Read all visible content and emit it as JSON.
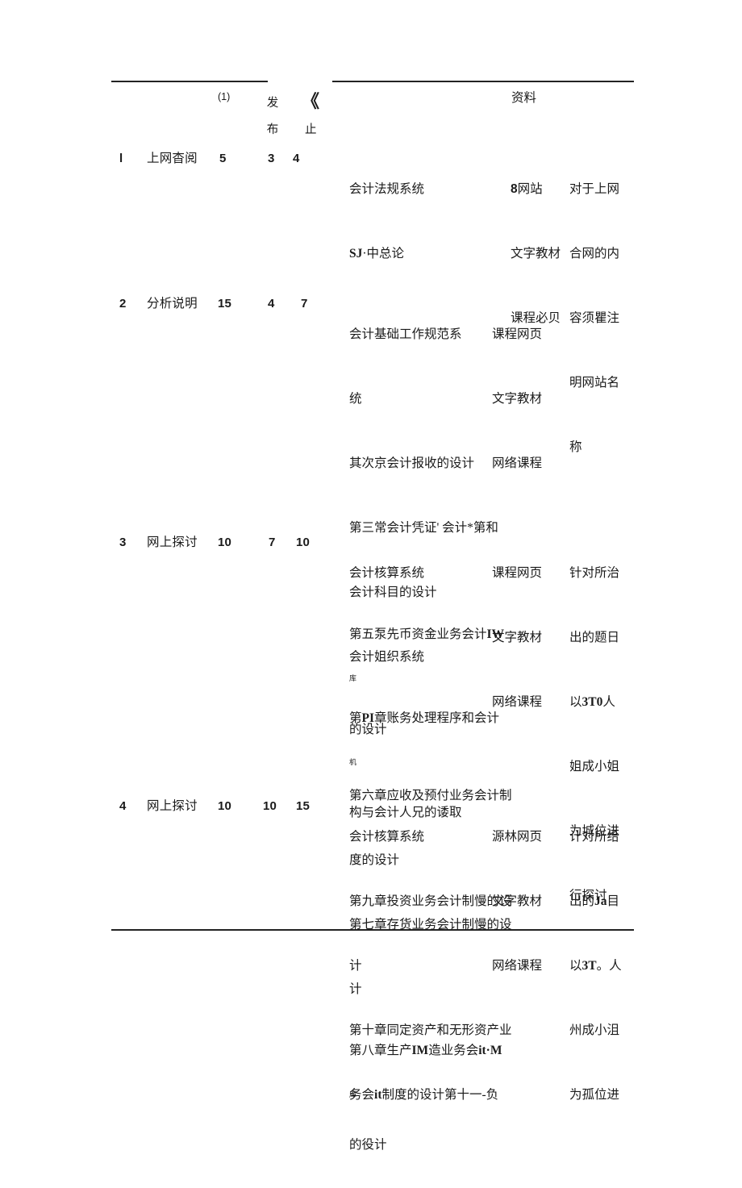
{
  "document": {
    "type": "table",
    "header": {
      "col_seq": "",
      "col_activity": "",
      "col_paren": "(1)",
      "col_fabu": [
        "发",
        "布"
      ],
      "col_chevron": "《",
      "col_zhi": "止",
      "col_content": "",
      "col_ziliao": "资料",
      "col_remark": ""
    },
    "rows": [
      {
        "seq": "l",
        "activity": "上网杳阅",
        "n1": "5",
        "n2": "3",
        "n3": "4",
        "content": [
          "会计法规系统",
          "SJ·中总论"
        ],
        "materials": [
          "8网站",
          "文字教材",
          "课程必贝"
        ],
        "remark": [
          "对于上网",
          "合网的内",
          "容须瞿注",
          "明网站名",
          "称"
        ]
      },
      {
        "seq": "2",
        "activity": "分析说明",
        "n1": "15",
        "n2": "4",
        "n3": "7",
        "content": [
          "会计基础工作规范系",
          "统",
          "其次京会计报收的设计",
          "第三常会计凭证' 会计*第和",
          "会计科目的设计",
          "会计姐织系统",
          "第PI章账务处理程序和会计",
          "构与会计人兄的诿取"
        ],
        "content_sub_after": {
          "6": "机"
        },
        "materials": [
          "课程网页",
          "文字教材",
          "网络课程"
        ],
        "remark": []
      },
      {
        "seq": "3",
        "activity": "网上探讨",
        "n1": "10",
        "n2": "7",
        "n3": "10",
        "content": [
          "会计核算系统",
          "第五泵先币资金业务会计IW",
          "的设计",
          "第六章应收及预付业务会计制",
          "度的设计",
          "第七章存货业务会计制慢的设",
          "计",
          "第八章生产IM造业务会it·M",
          "的役计"
        ],
        "content_sub_after": {
          "1": "库",
          "7": "库"
        },
        "materials": [
          "课程网页",
          "文字教材",
          "网络课程"
        ],
        "remark": [
          "针对所治",
          "出的题日",
          "以3T0人",
          "姐成小姐",
          "为城位进",
          "行探讨"
        ]
      },
      {
        "seq": "4",
        "activity": "网上探讨",
        "n1": "10",
        "n2": "10",
        "n3": "15",
        "content": [
          "会计核算系统",
          "第九章投资业务会计制慢的设",
          "计",
          "第十章同定资产和无形资产业",
          "务会it制度的设计第十一-负"
        ],
        "materials": [
          "源林网页",
          "文字教材",
          "网络课程"
        ],
        "remark": [
          "计对所给",
          "出的Ja目",
          "以3T。人",
          "州成小沮",
          "为孤位进"
        ]
      }
    ]
  }
}
